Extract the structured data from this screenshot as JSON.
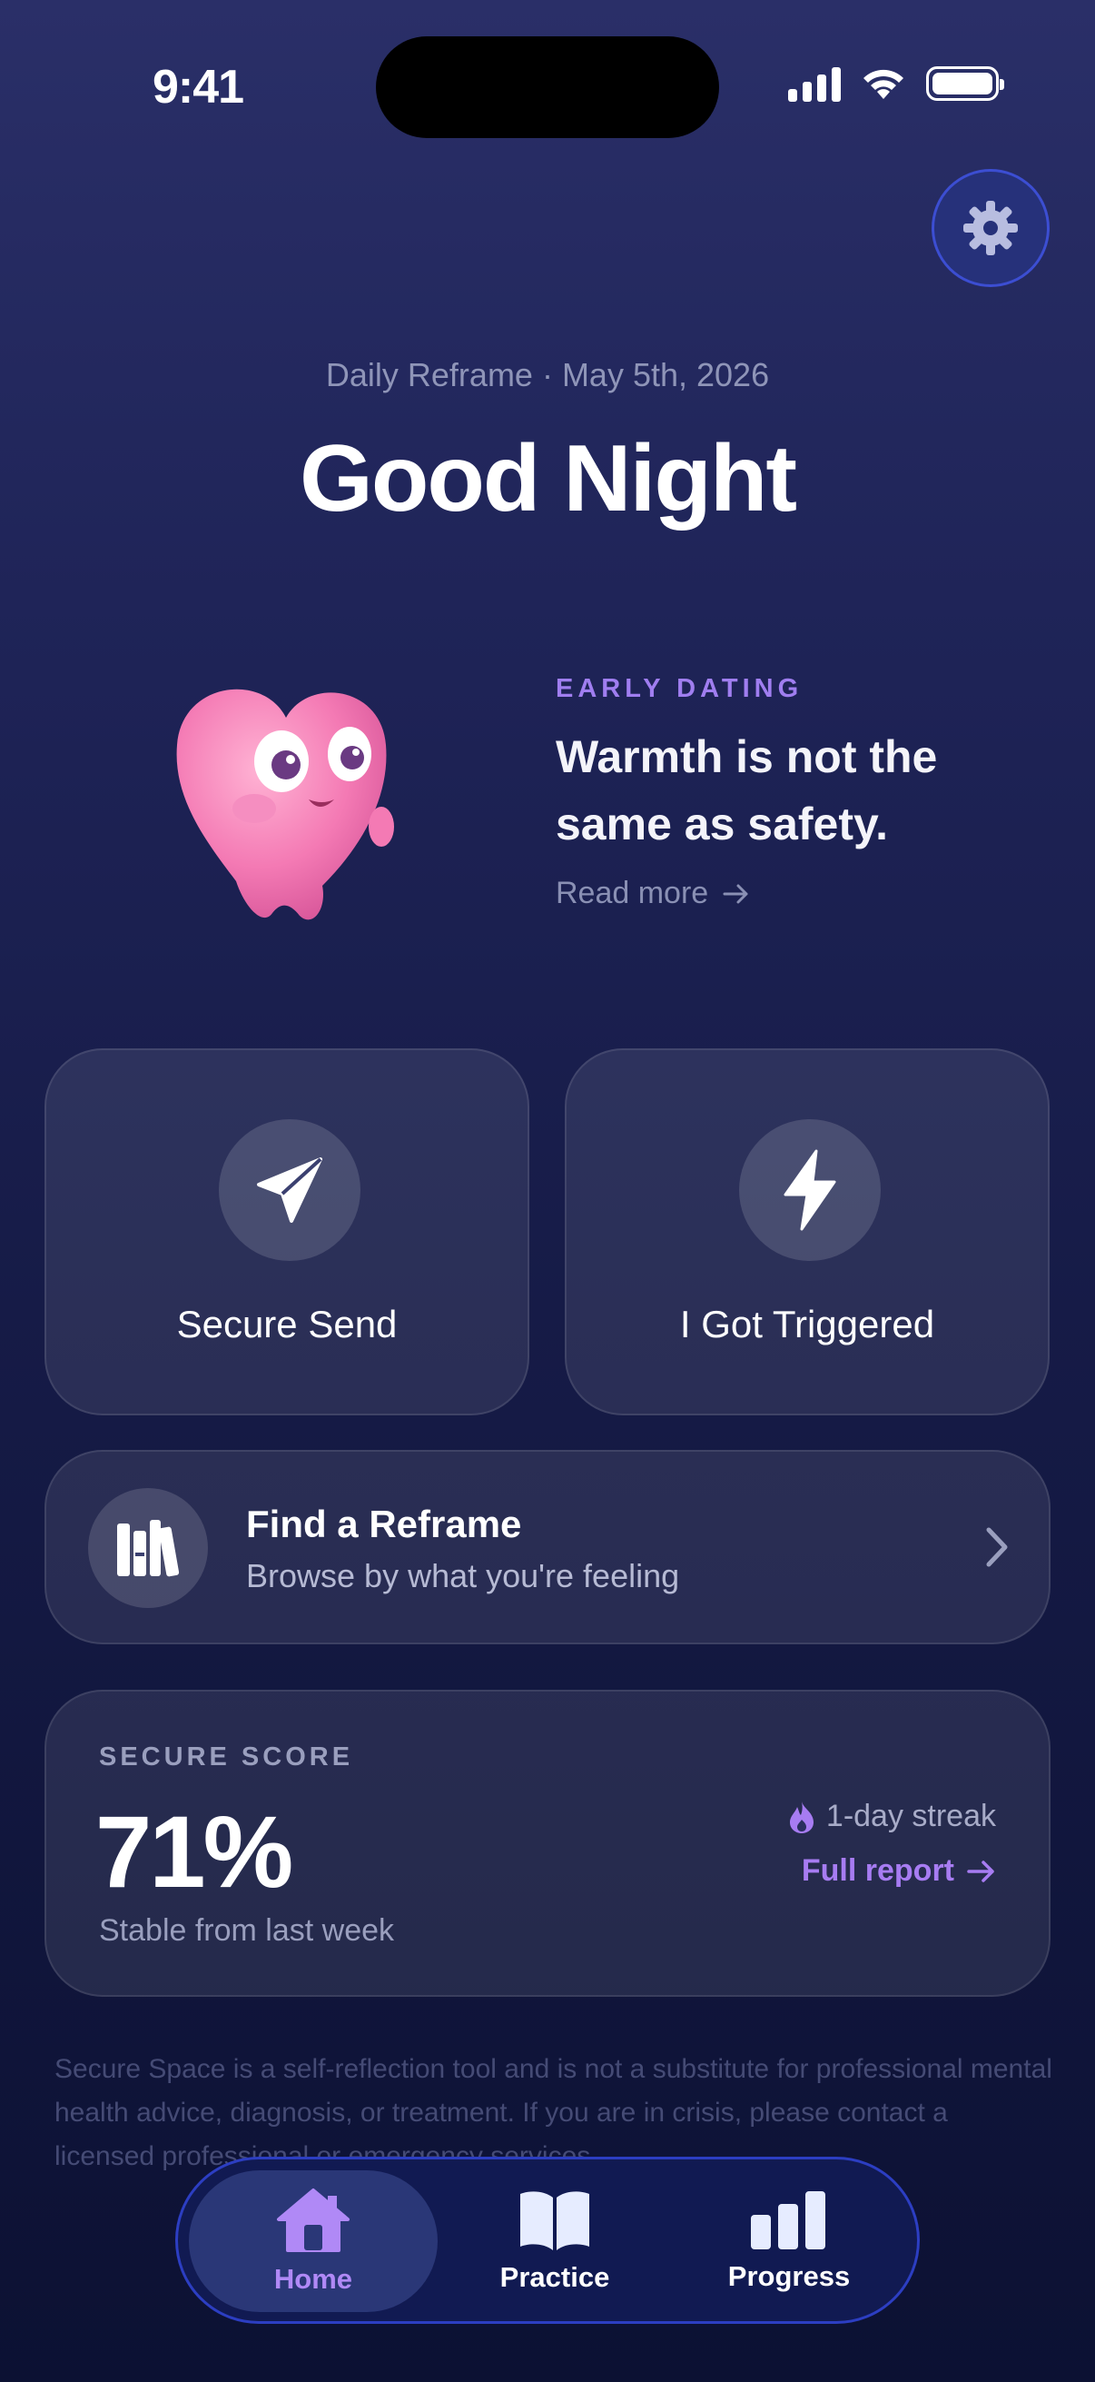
{
  "status_bar": {
    "time": "9:41"
  },
  "header": {
    "subtitle": "Daily Reframe · May 5th, 2026",
    "title": "Good Night"
  },
  "reframe": {
    "tag": "EARLY DATING",
    "quote": "Warmth is not the same as safety.",
    "read_more": "Read more"
  },
  "actions": [
    {
      "label": "Secure Send",
      "icon": "paper-plane-icon"
    },
    {
      "label": "I Got Triggered",
      "icon": "lightning-icon"
    }
  ],
  "find_reframe": {
    "title": "Find a Reframe",
    "subtitle": "Browse by what you're feeling",
    "icon": "books-icon"
  },
  "score": {
    "label": "SECURE SCORE",
    "value": "71%",
    "trend": "Stable from last week",
    "streak": "1-day streak",
    "report_link": "Full report"
  },
  "disclaimer": "Secure Space is a self-reflection tool and is not a substitute for professional mental health advice, diagnosis, or treatment. If you are in crisis, please contact a licensed professional or emergency services.",
  "tabs": [
    {
      "label": "Home",
      "icon": "home-icon",
      "active": true
    },
    {
      "label": "Practice",
      "icon": "book-icon",
      "active": false
    },
    {
      "label": "Progress",
      "icon": "bar-chart-icon",
      "active": false
    }
  ],
  "colors": {
    "accent": "#a77cf2",
    "tab_active_bg": "#2a3777",
    "settings_border": "#3c4ed2"
  }
}
